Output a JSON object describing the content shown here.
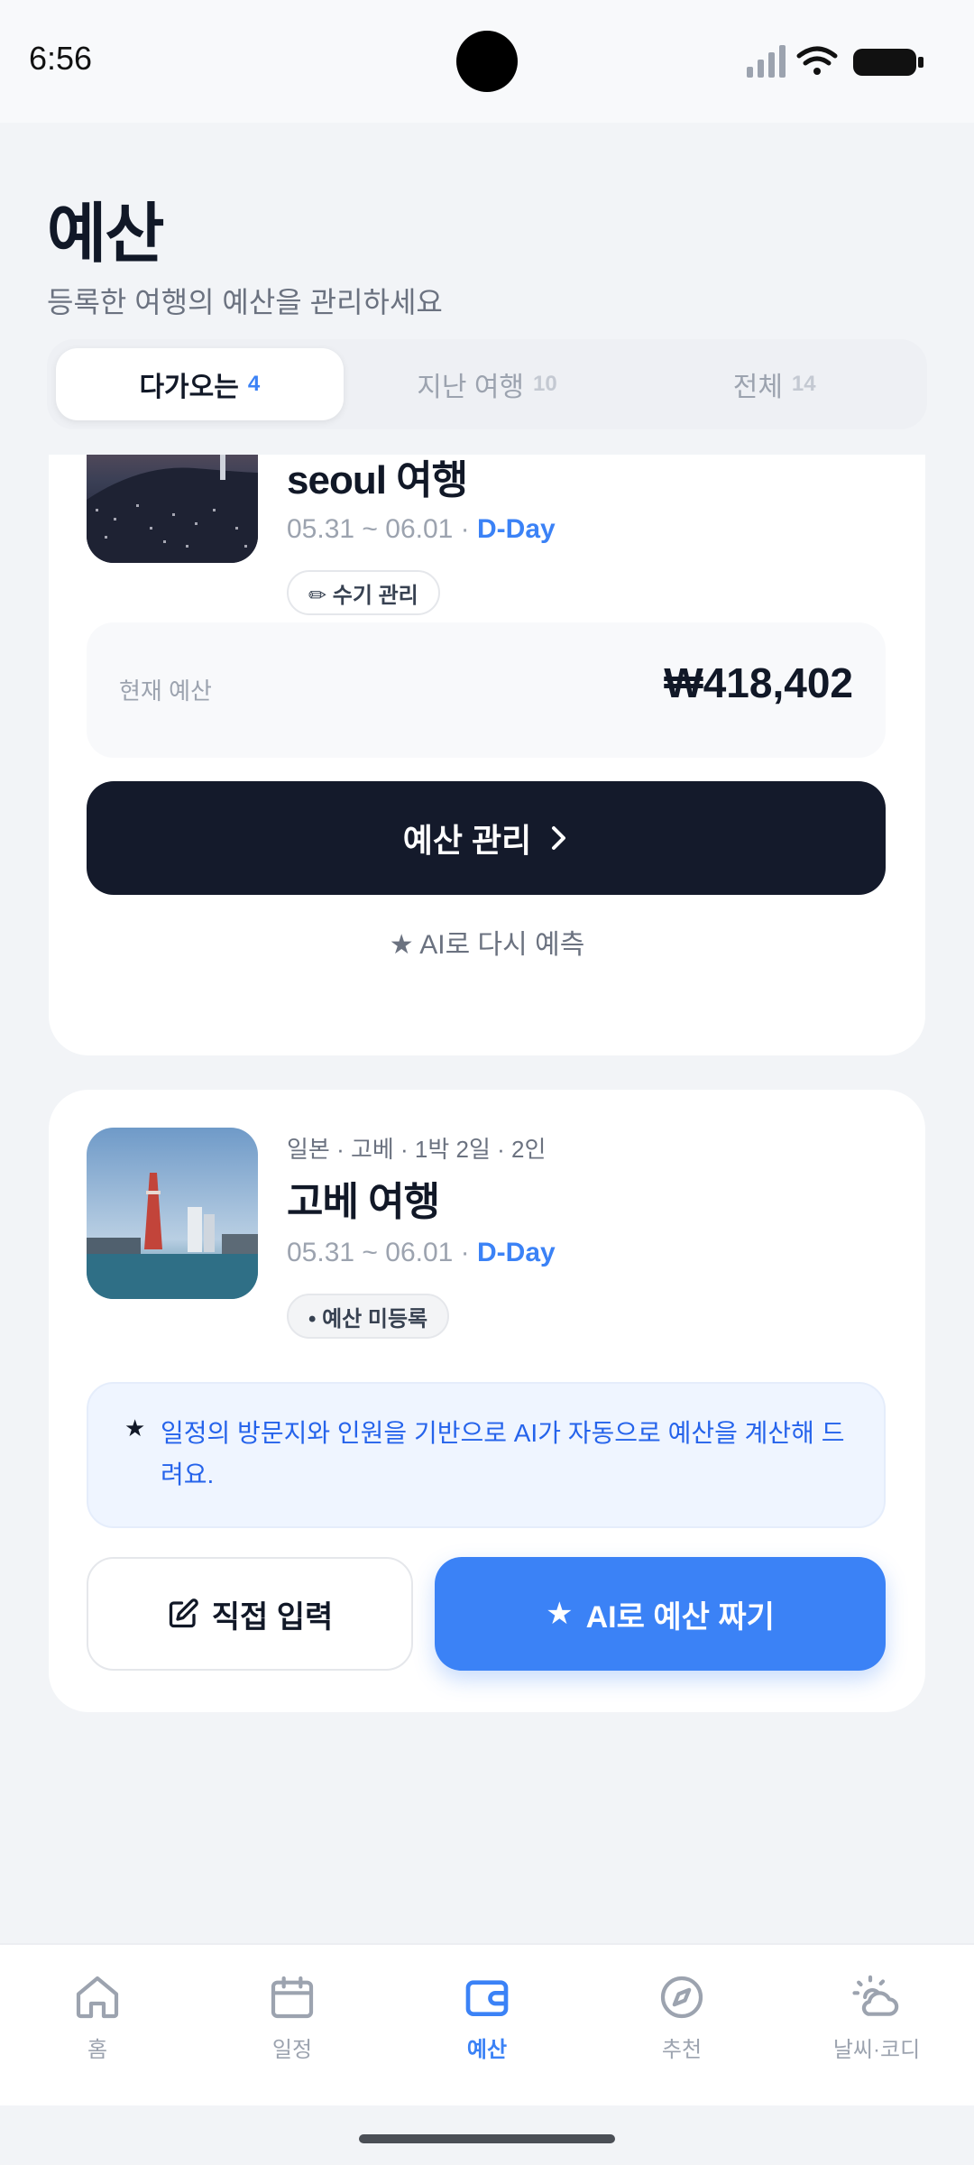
{
  "status_bar": {
    "time": "6:56"
  },
  "header": {
    "title": "예산",
    "subtitle": "등록한 여행의 예산을 관리하세요"
  },
  "tabs": [
    {
      "label": "다가오는",
      "count": "4"
    },
    {
      "label": "지난 여행",
      "count": "10"
    },
    {
      "label": "전체",
      "count": "14"
    }
  ],
  "trips": [
    {
      "title": "seoul 여행",
      "dates": "05.31 ~ 06.01 ·",
      "dday": "D-Day",
      "chip": "✏ 수기 관리",
      "budget_label": "현재 예산",
      "budget_value": "₩418,402",
      "manage_button": "예산 관리",
      "ai_link": "★ AI로 다시 예측"
    },
    {
      "meta": "일본 · 고베 · 1박 2일 · 2인",
      "title": "고베 여행",
      "dates": "05.31 ~ 06.01 ·",
      "dday": "D-Day",
      "chip": "• 예산 미등록",
      "info": "일정의 방문지와 인원을 기반으로 AI가 자동으로 예산을 계산해 드려요.",
      "manual_button": "직접 입력",
      "ai_button": "AI로 예산 짜기"
    }
  ],
  "bottom_nav": [
    {
      "label": "홈",
      "icon": "home-icon"
    },
    {
      "label": "일정",
      "icon": "calendar-icon"
    },
    {
      "label": "예산",
      "icon": "wallet-icon"
    },
    {
      "label": "추천",
      "icon": "compass-icon"
    },
    {
      "label": "날씨·코디",
      "icon": "weather-icon"
    }
  ],
  "colors": {
    "accent": "#3b82f6",
    "dark_button": "#141a2b"
  }
}
